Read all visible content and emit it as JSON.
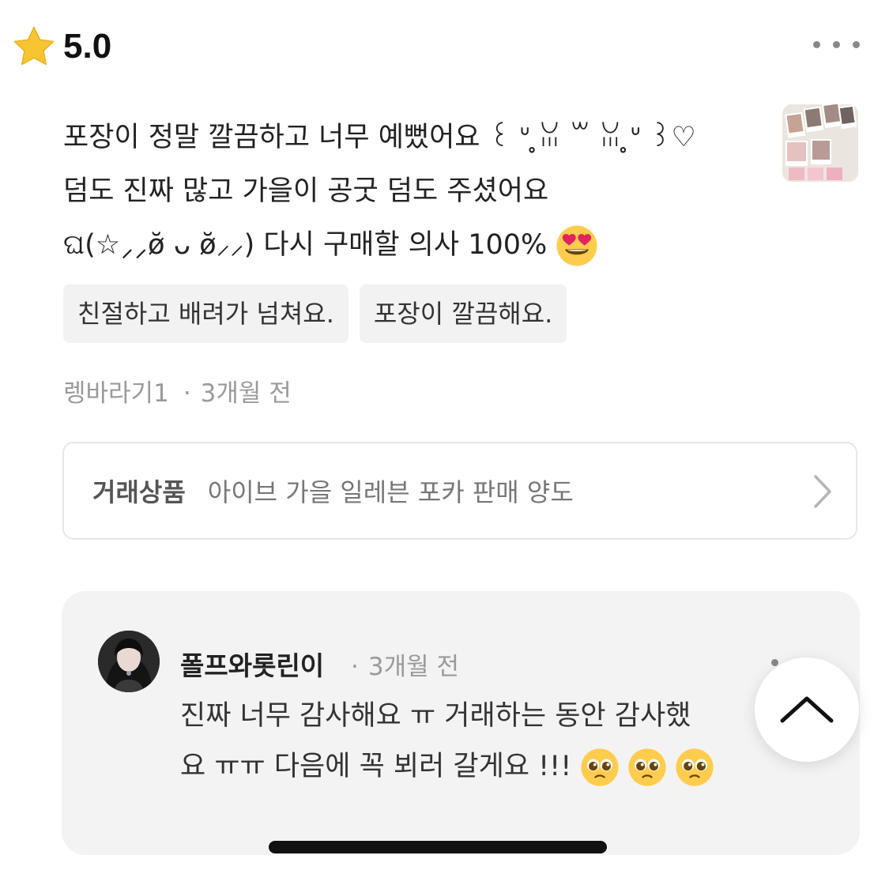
{
  "rating": {
    "value": "5.0",
    "icon": "star-icon",
    "color": "#F7C532"
  },
  "more_menu": {
    "icon": "more-horizontal-icon"
  },
  "review": {
    "lines": [
      "포장이 정말 깔끔하고 너무 예뻤어요 ꒰ ᐡ ̥ꈍ ꒳ ꈍ ̥ᐡ ꒱♡",
      "덤도 진짜 많고 가을이 공굿 덤도 주셨어요",
      "ଘ(☆⸝⸝ø̆ ᴗ ø̆⸝⸝) 다시 구매할 의사 100%"
    ],
    "emoji": "smiling-face-with-heart-eyes",
    "photo": "review-photo-photocards"
  },
  "tags": [
    "친절하고 배려가 넘쳐요.",
    "포장이 깔끔해요."
  ],
  "meta": {
    "author": "렝바라기1",
    "separator": "·",
    "time": "3개월 전"
  },
  "product": {
    "label": "거래상품",
    "name": "아이브 가을 일레븐 포카 판매 양도",
    "icon": "chevron-right-icon"
  },
  "reply": {
    "author": "폴프와롯린이",
    "separator": "·",
    "time": "3개월 전",
    "lines": [
      "진짜 너무 감사해요 ㅠ 거래하는 동안 감사했",
      "요 ㅠㅠ 다음에 꼭 뵈러 갈게요 !!!"
    ],
    "emoji": "pleading-face",
    "emoji_count": 3
  },
  "scroll_top": {
    "icon": "chevron-up-icon"
  }
}
